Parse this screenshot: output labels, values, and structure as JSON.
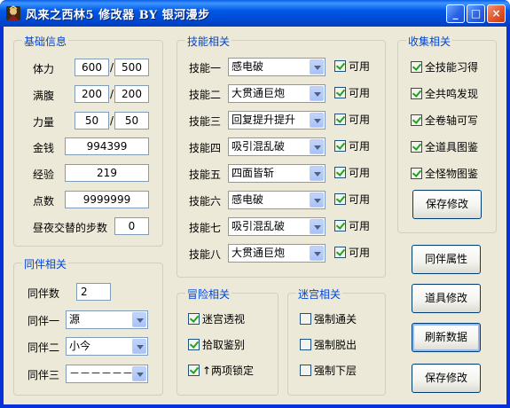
{
  "window": {
    "title": "风来之西林5 修改器 BY 银河漫步",
    "min": "_",
    "max": "□",
    "close": "×"
  },
  "basic": {
    "title": "基础信息",
    "rows": [
      {
        "label": "体力",
        "cur": "600",
        "sep": "/",
        "max": "500"
      },
      {
        "label": "满腹",
        "cur": "200",
        "sep": "/",
        "max": "200"
      },
      {
        "label": "力量",
        "cur": "50",
        "sep": "/",
        "max": "50"
      }
    ],
    "money_label": "金钱",
    "money": "994399",
    "exp_label": "经验",
    "exp": "219",
    "points_label": "点数",
    "points": "9999999",
    "steps_label": "昼夜交替的步数",
    "steps": "0"
  },
  "partner": {
    "title": "同伴相关",
    "count_label": "同伴数",
    "count": "2",
    "slots": [
      {
        "label": "同伴一",
        "value": "源"
      },
      {
        "label": "同伴二",
        "value": "小今"
      },
      {
        "label": "同伴三",
        "value": "－－－－－－"
      }
    ]
  },
  "skills": {
    "title": "技能相关",
    "rows": [
      {
        "label": "技能一",
        "value": "感电破",
        "check": "可用"
      },
      {
        "label": "技能二",
        "value": "大贯通巨炮",
        "check": "可用"
      },
      {
        "label": "技能三",
        "value": "回复提升提升",
        "check": "可用"
      },
      {
        "label": "技能四",
        "value": "吸引混乱破",
        "check": "可用"
      },
      {
        "label": "技能五",
        "value": "四面皆斩",
        "check": "可用"
      },
      {
        "label": "技能六",
        "value": "感电破",
        "check": "可用"
      },
      {
        "label": "技能七",
        "value": "吸引混乱破",
        "check": "可用"
      },
      {
        "label": "技能八",
        "value": "大贯通巨炮",
        "check": "可用"
      }
    ]
  },
  "collect": {
    "title": "收集相关",
    "items": [
      "全技能习得",
      "全共鸣发现",
      "全卷轴可写",
      "全道具图鉴",
      "全怪物图鉴"
    ],
    "save": "保存修改"
  },
  "adventure": {
    "title": "冒险相关",
    "items": [
      {
        "label": "迷宫透视",
        "checked": true
      },
      {
        "label": "拾取鉴别",
        "checked": true
      },
      {
        "label": "↑两项锁定",
        "checked": true
      }
    ]
  },
  "maze": {
    "title": "迷宫相关",
    "items": [
      {
        "label": "强制通关",
        "checked": false
      },
      {
        "label": "强制脱出",
        "checked": false
      },
      {
        "label": "强制下层",
        "checked": false
      }
    ]
  },
  "buttons": {
    "partner_attr": "同伴属性",
    "item_edit": "道具修改",
    "refresh": "刷新数据",
    "save": "保存修改"
  }
}
